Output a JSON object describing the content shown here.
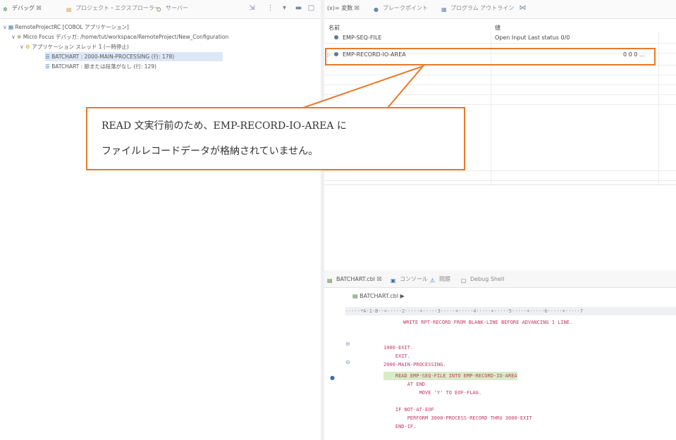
{
  "debug_panel": {
    "tabs": [
      {
        "label": "デバッグ ☒"
      },
      {
        "label": "プロジェクト・エクスプローラー"
      },
      {
        "label": "サーバー"
      }
    ],
    "tree": {
      "root": "RemoteProjectRC [COBOL アプリケーション]",
      "debugger": "Micro Focus デバッガ: /home/tut/workspace/RemoteProject/New_Configuration",
      "thread": "アプリケーション スレッド 1 (一時停止)",
      "frames": [
        {
          "label": "BATCHART : 2000-MAIN-PROCESSING (行: 178)"
        },
        {
          "label": "BATCHART : 節または段落がなし (行: 129)"
        }
      ]
    }
  },
  "vars_panel": {
    "tabs": [
      {
        "label": "(x)= 変数 ☒"
      },
      {
        "label": "ブレークポイント"
      },
      {
        "label": "プログラム アウトライン"
      }
    ],
    "columns": {
      "name": "名前",
      "value": "値"
    },
    "rows": [
      {
        "name": "EMP-SEQ-FILE",
        "value": "Open Input Last status 0/0"
      },
      {
        "name": "EMP-RECORD-IO-AREA",
        "value": "0 0 0 ..."
      }
    ]
  },
  "callout": {
    "line1": "READ 文実行前のため、EMP-RECORD-IO-AREA に",
    "line2": "ファイルレコードデータが格納されていません。"
  },
  "editor": {
    "tabs": [
      {
        "label": "BATCHART.cbl ☒"
      },
      {
        "label": "コンソール"
      },
      {
        "label": "問題"
      },
      {
        "label": "Debug Shell"
      }
    ],
    "breadcrumb": "BATCHART.cbl ▶",
    "ruler": "·····*A·1·B··+·····2·····+·····3·····+·····4·····+·····5·····+·····6·····+·····7",
    "lines": [
      "WRITE RPT-RECORD FROM BLANK-LINE BEFORE ADVANCING 1 LINE.",
      "",
      "1000-EXIT.",
      "    EXIT.",
      "2000-MAIN-PROCESSING.",
      "    READ EMP-SEQ-FILE INTO EMP-RECORD-IO-AREA",
      "        AT END",
      "            MOVE 'Y' TO EOF-FLAG.",
      "",
      "    IF NOT-AT-EOF",
      "        PERFORM 3000-PROCESS-RECORD THRU 3000-EXIT",
      "    END-IF."
    ]
  },
  "colors": {
    "accent": "#e8792b",
    "code": "#c03a6a",
    "selection": "#dde8f6",
    "current_line": "#d9ecc6"
  }
}
